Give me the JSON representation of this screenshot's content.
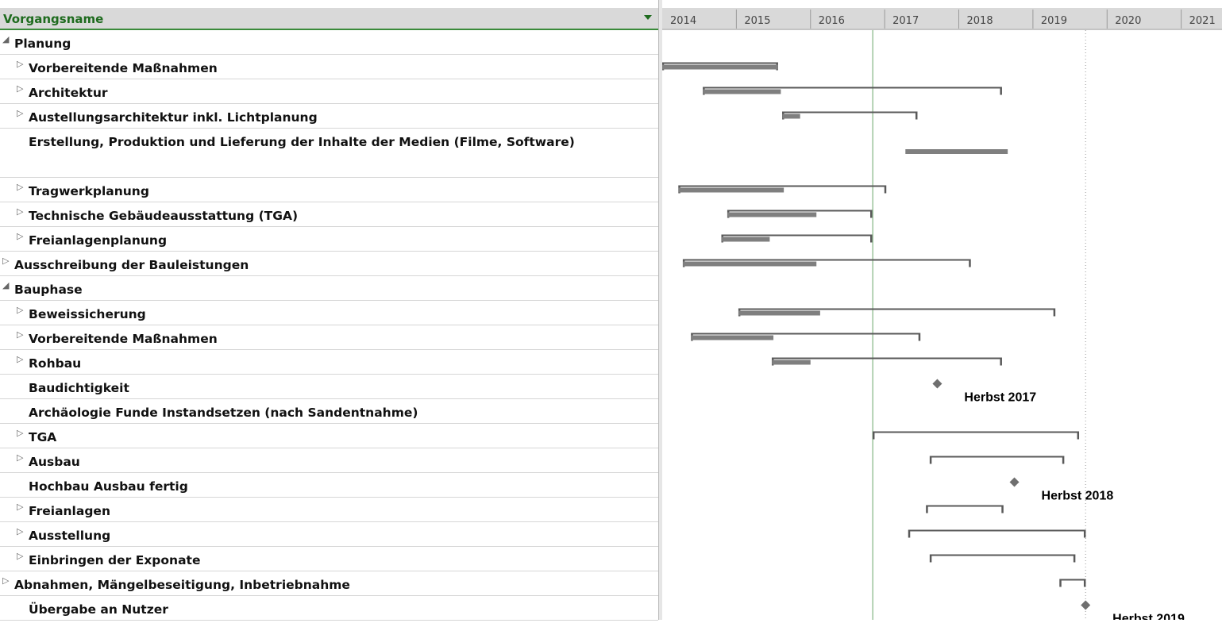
{
  "left_panel": {
    "header": "Vorgangsname",
    "rows": [
      {
        "label": "Planung",
        "level": 0,
        "expander": "expanded"
      },
      {
        "label": "Vorbereitende Maßnahmen",
        "level": 1,
        "expander": "collapsed"
      },
      {
        "label": "Architektur",
        "level": 1,
        "expander": "collapsed"
      },
      {
        "label": "Austellungsarchitektur inkl. Lichtplanung",
        "level": 1,
        "expander": "collapsed"
      },
      {
        "label": "Erstellung, Produktion und Lieferung der Inhalte der Medien (Filme, Software)",
        "level": 1,
        "expander": "none",
        "tall": true
      },
      {
        "label": "Tragwerkplanung",
        "level": 1,
        "expander": "collapsed"
      },
      {
        "label": "Technische Gebäudeausstattung (TGA)",
        "level": 1,
        "expander": "collapsed"
      },
      {
        "label": "Freianlagenplanung",
        "level": 1,
        "expander": "collapsed"
      },
      {
        "label": "Ausschreibung der Bauleistungen",
        "level": 0,
        "expander": "collapsed"
      },
      {
        "label": "Bauphase",
        "level": 0,
        "expander": "expanded"
      },
      {
        "label": "Beweissicherung",
        "level": 1,
        "expander": "collapsed"
      },
      {
        "label": "Vorbereitende Maßnahmen",
        "level": 1,
        "expander": "collapsed"
      },
      {
        "label": "Rohbau",
        "level": 1,
        "expander": "collapsed"
      },
      {
        "label": "Baudichtigkeit",
        "level": 1,
        "expander": "none"
      },
      {
        "label": "Archäologie Funde Instandsetzen (nach Sandentnahme)",
        "level": 1,
        "expander": "none"
      },
      {
        "label": "TGA",
        "level": 1,
        "expander": "collapsed"
      },
      {
        "label": "Ausbau",
        "level": 1,
        "expander": "collapsed"
      },
      {
        "label": "Hochbau Ausbau fertig",
        "level": 1,
        "expander": "none"
      },
      {
        "label": "Freianlagen",
        "level": 1,
        "expander": "collapsed"
      },
      {
        "label": "Ausstellung",
        "level": 1,
        "expander": "collapsed"
      },
      {
        "label": "Einbringen der Exponate",
        "level": 1,
        "expander": "collapsed"
      },
      {
        "label": "Abnahmen, Mängelbeseitigung, Inbetriebnahme",
        "level": 0,
        "expander": "collapsed"
      },
      {
        "label": "Übergabe an Nutzer",
        "level": 1,
        "expander": "none"
      }
    ]
  },
  "timeline": {
    "years": [
      "2014",
      "2015",
      "2016",
      "2017",
      "2018",
      "2019",
      "2020",
      "2021"
    ],
    "start_year": 2014,
    "end_year": 2021.55,
    "today_marker": 2016.84,
    "status_line": 2019.71,
    "colors": {
      "header_bg": "#d9d9d9",
      "header_accent": "#3a8a3a",
      "bar": "#7f7f7f",
      "summary": "#595959",
      "today": "#9bc39b",
      "milestone": "#6f6f6f"
    }
  },
  "chart_data": {
    "type": "gantt",
    "x_unit": "year",
    "tasks": [
      {
        "row": 1,
        "summary": [
          2014.0,
          2015.56
        ],
        "progress": [
          2014.0,
          2015.56
        ]
      },
      {
        "row": 2,
        "summary": [
          2014.55,
          2018.58
        ],
        "progress": [
          2014.55,
          2015.6
        ]
      },
      {
        "row": 3,
        "summary": [
          2015.62,
          2017.44
        ],
        "progress": [
          2015.62,
          2015.86
        ]
      },
      {
        "row": 4,
        "progress": [
          2017.28,
          2018.66
        ]
      },
      {
        "row": 5,
        "summary": [
          2014.22,
          2017.02
        ],
        "progress": [
          2014.22,
          2015.64
        ]
      },
      {
        "row": 6,
        "summary": [
          2014.88,
          2016.83
        ],
        "progress": [
          2014.88,
          2016.08
        ]
      },
      {
        "row": 7,
        "summary": [
          2014.8,
          2016.83
        ],
        "progress": [
          2014.8,
          2015.45
        ]
      },
      {
        "row": 8,
        "summary": [
          2014.28,
          2018.16
        ],
        "progress": [
          2014.28,
          2016.08
        ]
      },
      {
        "row": 10,
        "summary": [
          2015.03,
          2019.3
        ],
        "progress": [
          2015.03,
          2016.13
        ]
      },
      {
        "row": 11,
        "summary": [
          2014.39,
          2017.48
        ],
        "progress": [
          2014.39,
          2015.5
        ]
      },
      {
        "row": 12,
        "summary": [
          2015.48,
          2018.58
        ],
        "progress": [
          2015.48,
          2016.0
        ]
      },
      {
        "row": 15,
        "summary": [
          2016.84,
          2019.62
        ]
      },
      {
        "row": 16,
        "summary": [
          2017.61,
          2019.42
        ]
      },
      {
        "row": 18,
        "summary": [
          2017.56,
          2018.6
        ]
      },
      {
        "row": 19,
        "summary": [
          2017.32,
          2019.71
        ]
      },
      {
        "row": 20,
        "summary": [
          2017.61,
          2019.57
        ]
      },
      {
        "row": 21,
        "summary": [
          2019.36,
          2019.71
        ]
      }
    ],
    "milestones": [
      {
        "row": 13,
        "x": 2017.71,
        "label": "Herbst 2017"
      },
      {
        "row": 17,
        "x": 2018.75,
        "label": "Herbst 2018"
      },
      {
        "row": 22,
        "x": 2019.71,
        "label": "Herbst  2019"
      }
    ]
  }
}
